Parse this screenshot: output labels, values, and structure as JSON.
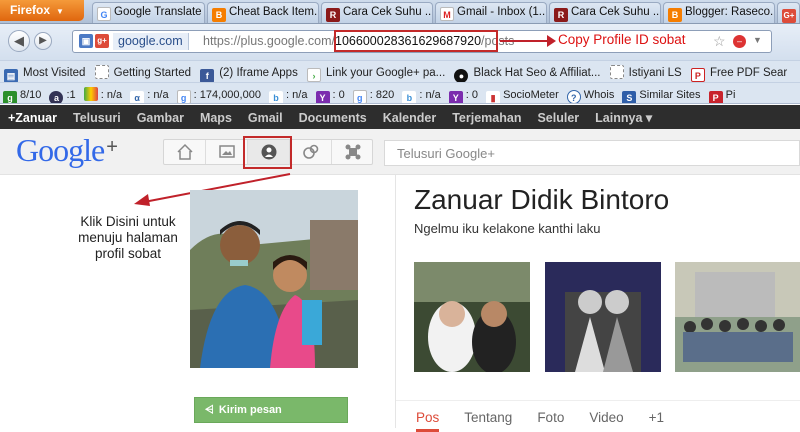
{
  "browser": {
    "menu_label": "Firefox",
    "tabs": [
      {
        "label": "Google Translate",
        "icon": "translate-icon"
      },
      {
        "label": "Cheat Back Item...",
        "icon": "blogger-icon"
      },
      {
        "label": "Cara Cek Suhu ...",
        "icon": "site-r-icon"
      },
      {
        "label": "Gmail - Inbox (1...",
        "icon": "gmail-icon"
      },
      {
        "label": "Cara Cek Suhu ...",
        "icon": "site-r-icon"
      },
      {
        "label": "Blogger: Raseco...",
        "icon": "blogger-icon"
      },
      {
        "label": "G+",
        "icon": "gplus-icon"
      }
    ],
    "address": {
      "site_badge": "google.com",
      "url_prefix": "https://plus.google.com/",
      "profile_id": "106600028361629687920",
      "url_suffix": "/posts"
    },
    "bookmarks": [
      "Most Visited",
      "Getting Started",
      "(2) Iframe Apps",
      "Link your Google+ pa...",
      "Black Hat Seo & Affiliat...",
      "Istiyani LS",
      "Free PDF Sear"
    ],
    "seo_toolbar": [
      "8/10",
      ":1",
      ": n/a",
      ": n/a",
      ": 174,000,000",
      ": n/a",
      ": 0",
      ": 820",
      ": n/a",
      ": 0",
      "SocioMeter",
      "Whois",
      "Similar Sites",
      "Pi"
    ]
  },
  "annotation": {
    "copy_label": "Copy Profile ID sobat",
    "klik_label": "Klik Disini untuk menuju halaman profil sobat",
    "arrow_color": "#c0212a"
  },
  "gbar": {
    "items": [
      "+Zanuar",
      "Telusuri",
      "Gambar",
      "Maps",
      "Gmail",
      "Documents",
      "Kalender",
      "Terjemahan",
      "Seluler",
      "Lainnya ▾"
    ]
  },
  "gplus": {
    "logo": "Google",
    "search_placeholder": "Telusuri Google+",
    "send_message": "Kirim pesan"
  },
  "profile": {
    "name": "Zanuar Didik Bintoro",
    "tagline": "Ngelmu iku kelakone kanthi laku",
    "tabs": [
      "Pos",
      "Tentang",
      "Foto",
      "Video",
      "+1"
    ]
  },
  "colors": {
    "accent": "#dd4b39",
    "send_button": "#7ab86a",
    "annotation": "#c32a2a"
  }
}
